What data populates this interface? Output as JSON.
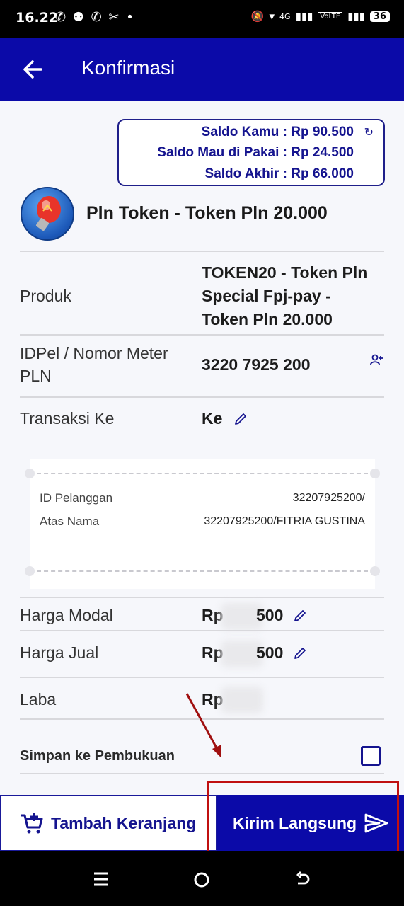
{
  "status_bar": {
    "time": "16.22",
    "icons_left": "✆ ⚉ ✆ ✂ •",
    "network": "4G",
    "volte": "VoLTE",
    "battery": "36"
  },
  "app_bar": {
    "title": "Konfirmasi",
    "back_icon": "arrow-left-icon"
  },
  "saldo": {
    "kamu": "Saldo Kamu : Rp 90.500",
    "mau_dipakai": "Saldo Mau di Pakai : Rp 24.500",
    "akhir": "Saldo Akhir  : Rp 66.000"
  },
  "product": {
    "title": "Pln Token -  Token Pln 20.000",
    "icon": "light-bulb-icon"
  },
  "details": {
    "produk_label": "Produk",
    "produk_value_lines": [
      "TOKEN20 - Token Pln",
      "Special Fpj-pay -",
      "Token Pln 20.000"
    ],
    "idpel_label_lines": [
      "IDPel / Nomor Meter",
      "PLN"
    ],
    "idpel_value": "3220 7925 200",
    "transaksi_label": "Transaksi Ke",
    "transaksi_value": "Ke"
  },
  "receipt": {
    "id_label": "ID Pelanggan",
    "id_value": "32207925200/",
    "nama_label": "Atas Nama",
    "nama_value": "32207925200/FITRIA GUSTINA"
  },
  "pricing": {
    "modal_label": "Harga Modal",
    "modal_prefix": "Rp",
    "modal_suffix": "500",
    "jual_label": "Harga Jual",
    "jual_prefix": "Rp",
    "jual_suffix": "500",
    "laba_label": "Laba",
    "laba_prefix": "Rp"
  },
  "simpan": {
    "label": "Simpan ke Pembukuan",
    "checked": false
  },
  "buttons": {
    "cart": "Tambah Keranjang",
    "send": "Kirim Langsung"
  },
  "colors": {
    "primary": "#0b0aa8",
    "annotation": "#c01010"
  }
}
